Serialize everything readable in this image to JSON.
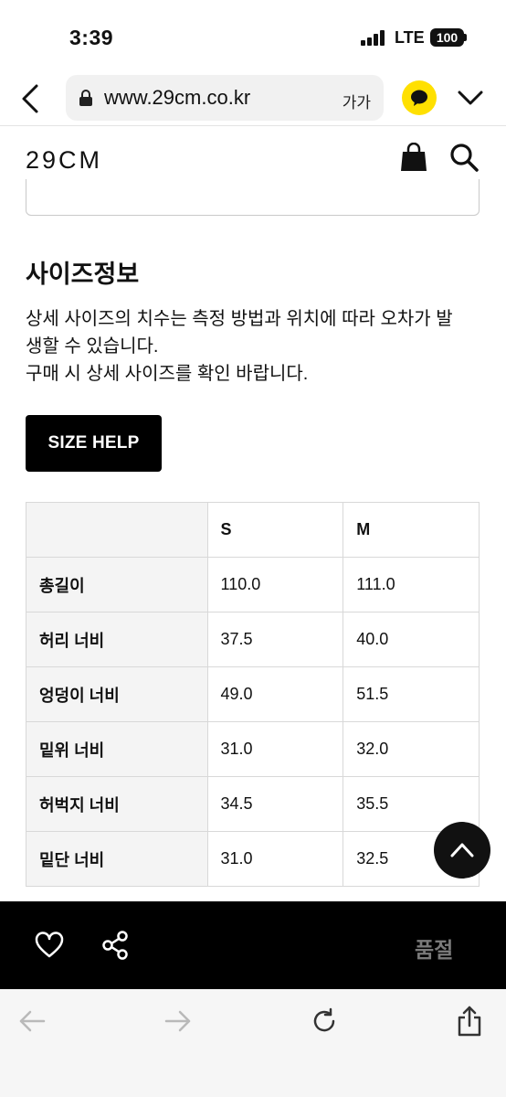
{
  "status_bar": {
    "time": "3:39",
    "carrier": "LTE",
    "battery": "100"
  },
  "browser": {
    "url": "www.29cm.co.kr",
    "text_size": "가가"
  },
  "site": {
    "logo": "29CM"
  },
  "size_info": {
    "title": "사이즈정보",
    "description_lines": [
      "상세 사이즈의 치수는 측정 방법과 위치에 따라 오차가 발",
      "생할 수 있습니다.",
      "구매 시 상세 사이즈를 확인 바랍니다."
    ],
    "help_button": "SIZE HELP",
    "table": {
      "headers": [
        "",
        "S",
        "M"
      ],
      "rows": [
        [
          "총길이",
          "110.0",
          "111.0"
        ],
        [
          "허리 너비",
          "37.5",
          "40.0"
        ],
        [
          "엉덩이 너비",
          "49.0",
          "51.5"
        ],
        [
          "밑위 너비",
          "31.0",
          "32.0"
        ],
        [
          "허벅지 너비",
          "34.5",
          "35.5"
        ],
        [
          "밑단 너비",
          "31.0",
          "32.5"
        ]
      ]
    }
  },
  "action_bar": {
    "status_label": "품절"
  },
  "colors": {
    "accent_black": "#000000",
    "kakao_yellow": "#FFE000",
    "soldout_gray": "#7A7A7A"
  },
  "icons": [
    "lock-icon",
    "kakaotalk-icon",
    "bag-icon",
    "search-icon",
    "heart-icon",
    "share-icon",
    "arrow-up-icon",
    "back-arrow-icon",
    "forward-arrow-icon",
    "reload-icon",
    "share-box-icon"
  ]
}
